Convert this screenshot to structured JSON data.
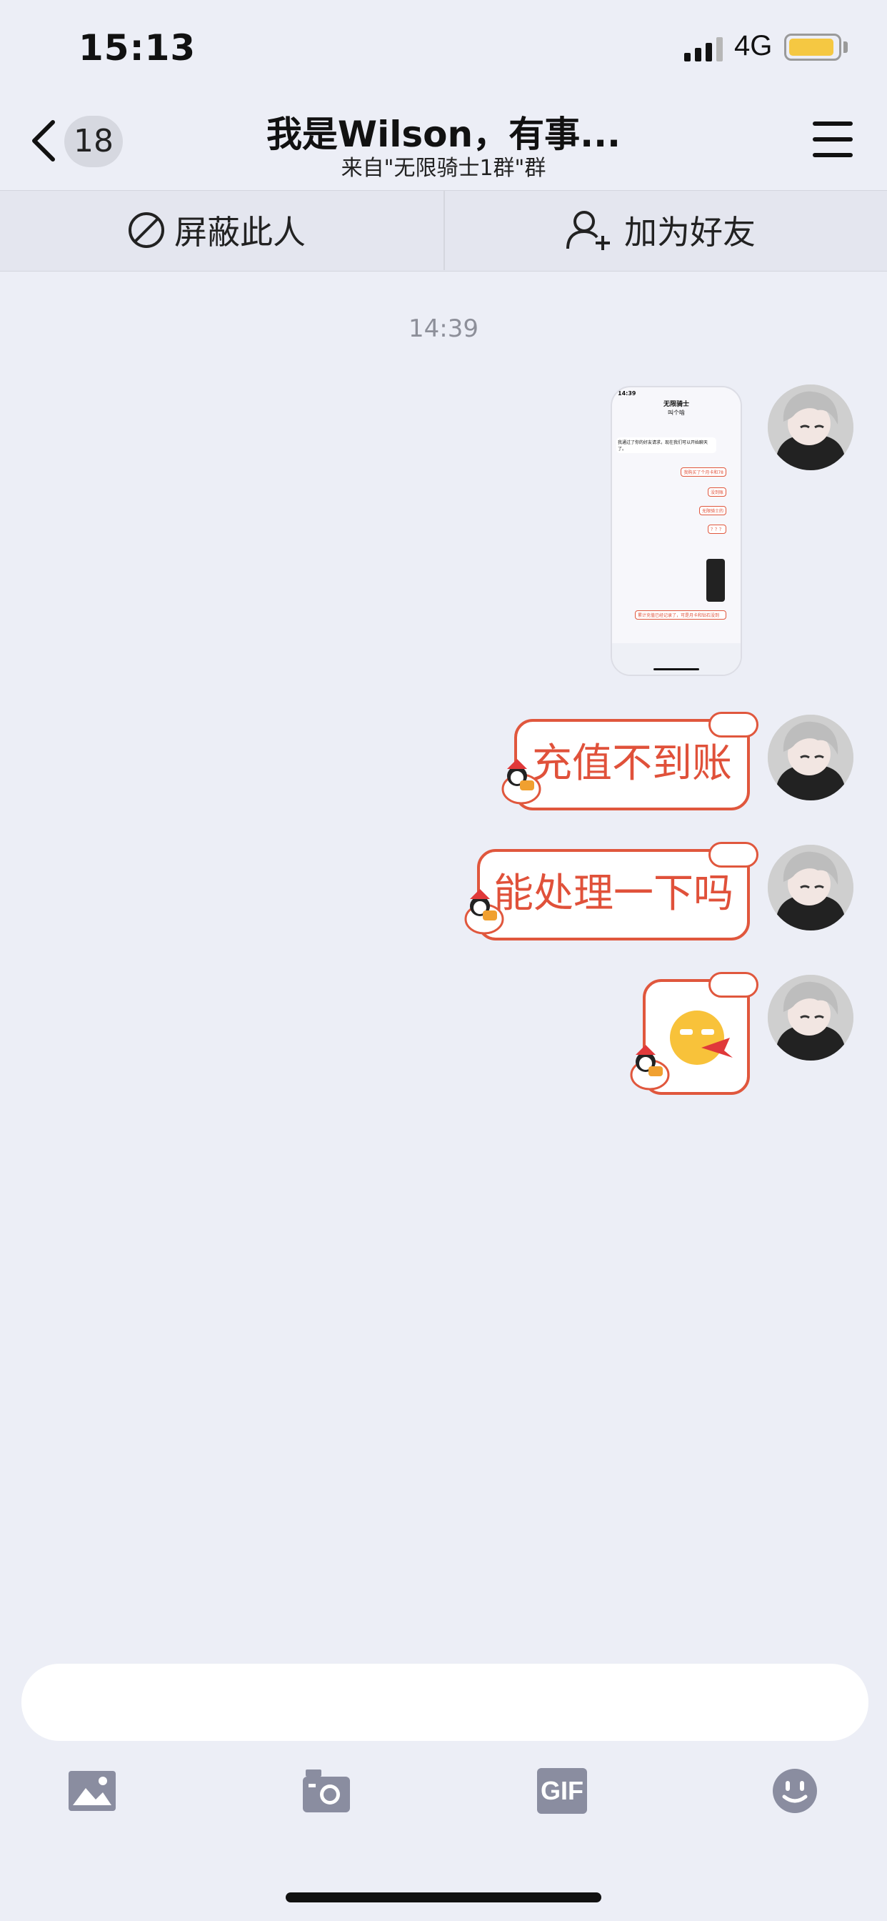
{
  "status_bar": {
    "time": "15:13",
    "network": "4G",
    "battery_color": "#f5c842"
  },
  "nav": {
    "unread_count": "18",
    "title": "我是Wilson，有事...",
    "subtitle": "来自\"无限骑士1群\"群"
  },
  "actions": {
    "block_label": "屏蔽此人",
    "add_friend_label": "加为好友"
  },
  "chat": {
    "timestamp": "14:39",
    "messages": [
      {
        "type": "image",
        "content": "screenshot"
      },
      {
        "type": "text",
        "content": "充值不到账"
      },
      {
        "type": "text",
        "content": "能处理一下吗"
      },
      {
        "type": "sticker",
        "content": "angry-emoji"
      }
    ],
    "screenshot_preview": {
      "time": "14:39",
      "title": "无限骑士",
      "subtitle": "叫个啥",
      "lines": [
        "我通过了你的好友请求，现在我们可以开始聊天了。",
        "我购买了个月卡和78",
        "没到账",
        "无限骑士的",
        "？？？",
        "累计充值已经记录了，可是月卡和钻石没到"
      ]
    }
  },
  "toolbar": {
    "icons": [
      "image-icon",
      "camera-icon",
      "gif-icon",
      "emoji-icon"
    ],
    "gif_label": "GIF"
  },
  "colors": {
    "accent": "#e0573d",
    "background": "#eceef6"
  }
}
